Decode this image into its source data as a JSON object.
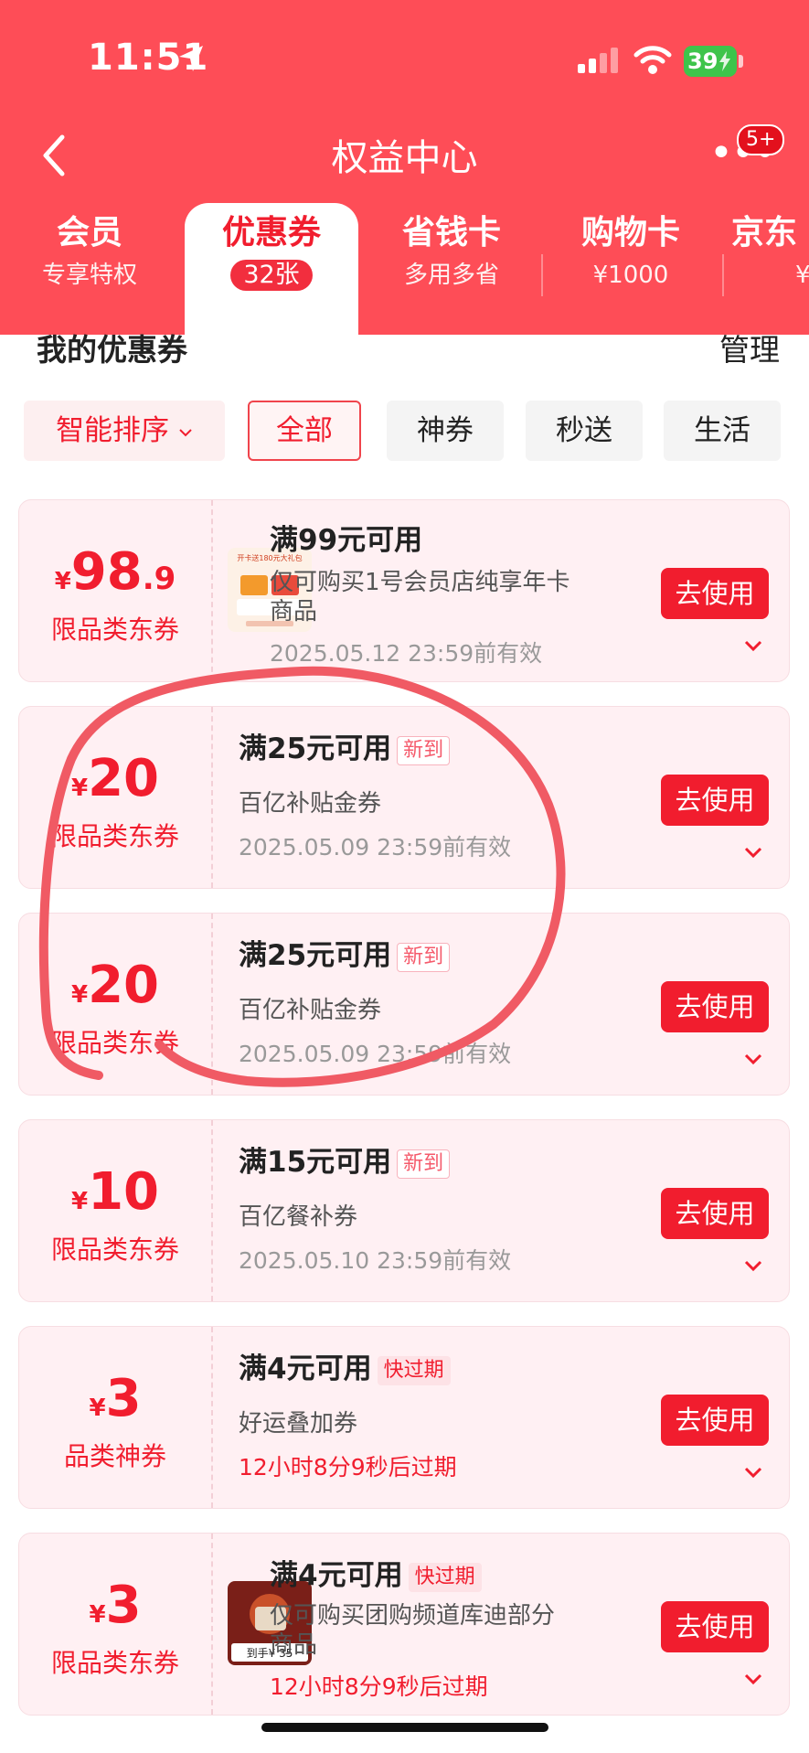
{
  "status": {
    "time": "11:51",
    "battery": "39"
  },
  "header": {
    "title": "权益中心",
    "badge": "5+"
  },
  "tabs": [
    {
      "label": "会员",
      "sub": "专享特权"
    },
    {
      "label": "优惠券",
      "sub": "32张"
    },
    {
      "label": "省钱卡",
      "sub": "多用多省"
    },
    {
      "label": "购物卡",
      "sub": "¥1000"
    },
    {
      "label": "京东",
      "sub": "¥"
    }
  ],
  "section": {
    "title": "我的优惠券",
    "manage": "管理"
  },
  "filters": {
    "sort": "智能排序",
    "items": [
      "全部",
      "神券",
      "秒送",
      "生活"
    ]
  },
  "coupons": [
    {
      "cur": "¥",
      "num": "98",
      "dec": ".9",
      "type": "限品类东券",
      "condition": "满99元可用",
      "tag": "",
      "desc": "仅可购买1号会员店纯享年卡商品",
      "expiry": "2025.05.12 23:59前有效",
      "button": "去使用"
    },
    {
      "cur": "¥",
      "num": "20",
      "dec": "",
      "type": "限品类东券",
      "condition": "满25元可用",
      "tag": "新到",
      "desc": "百亿补贴金券",
      "expiry": "2025.05.09 23:59前有效",
      "button": "去使用"
    },
    {
      "cur": "¥",
      "num": "20",
      "dec": "",
      "type": "限品类东券",
      "condition": "满25元可用",
      "tag": "新到",
      "desc": "百亿补贴金券",
      "expiry": "2025.05.09 23:59前有效",
      "button": "去使用"
    },
    {
      "cur": "¥",
      "num": "10",
      "dec": "",
      "type": "限品类东券",
      "condition": "满15元可用",
      "tag": "新到",
      "desc": "百亿餐补券",
      "expiry": "2025.05.10 23:59前有效",
      "button": "去使用"
    },
    {
      "cur": "¥",
      "num": "3",
      "dec": "",
      "type": "品类神券",
      "condition": "满4元可用",
      "tag": "快过期",
      "desc": "好运叠加券",
      "expiry": "12小时8分9秒后过期",
      "button": "去使用"
    },
    {
      "cur": "¥",
      "num": "3",
      "dec": "",
      "type": "限品类东券",
      "condition": "满4元可用",
      "tag": "快过期",
      "desc": "仅可购买团购频道库迪部分商品",
      "expiry": "12小时8分9秒后过期",
      "button": "去使用"
    }
  ],
  "thumbs": {
    "first": "开卡送180元大礼包",
    "last_price": "到手¥ 35"
  }
}
